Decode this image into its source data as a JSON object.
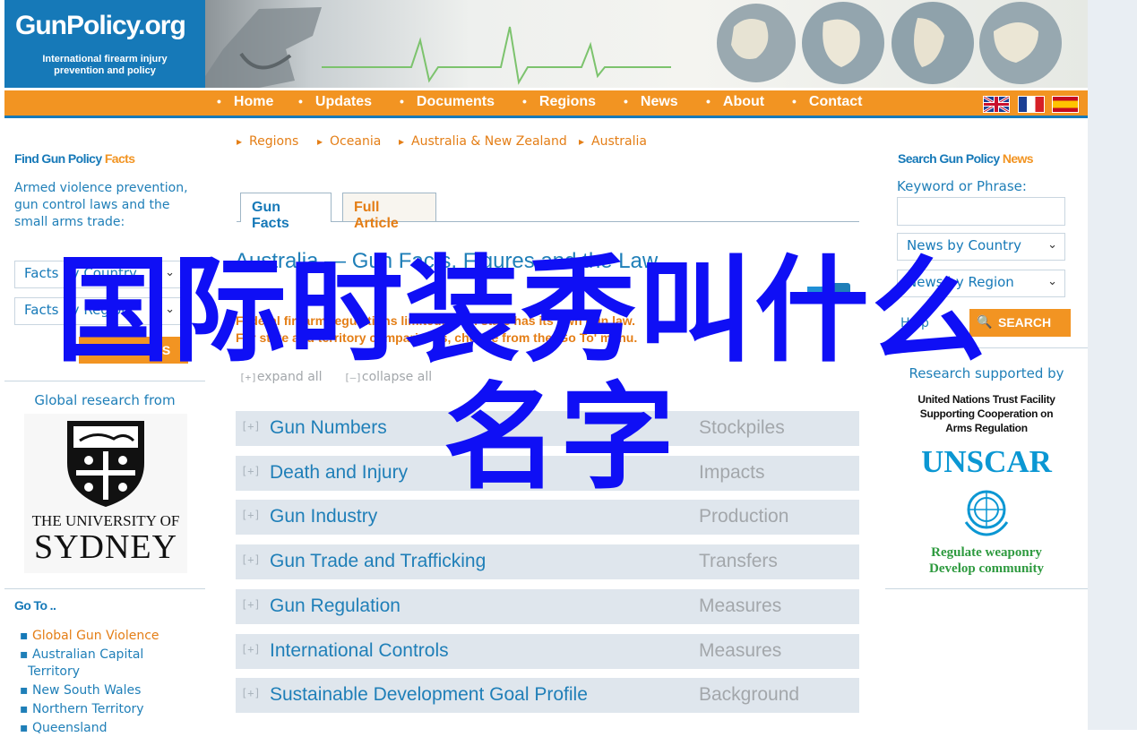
{
  "site": {
    "logo_title": "GunPolicy.org",
    "logo_subtitle_1": "International firearm injury",
    "logo_subtitle_2": "prevention and policy"
  },
  "nav": {
    "items": [
      "Home",
      "Updates",
      "Documents",
      "Regions",
      "News",
      "About",
      "Contact"
    ],
    "flags": [
      "english-flag-icon",
      "french-flag-icon",
      "spanish-flag-icon"
    ]
  },
  "breadcrumb": [
    "Regions",
    "Oceania",
    "Australia & New Zealand",
    "Australia"
  ],
  "tabs": {
    "active": "Gun Facts",
    "other": "Full Article"
  },
  "article": {
    "title": "Australia — Gun Facts, Figures and the Law",
    "notice_1": "Federal firearm regulations limited: each state has its own gun law.",
    "notice_2": "For state and territory comparisons, choose from the 'Go To' menu.",
    "expand_all": "expand all",
    "collapse_all": "collapse all",
    "expand_glyph": "[+]",
    "collapse_glyph": "[–]"
  },
  "sections": [
    {
      "label": "Gun Numbers",
      "category": "Stockpiles"
    },
    {
      "label": "Death and Injury",
      "category": "Impacts"
    },
    {
      "label": "Gun Industry",
      "category": "Production"
    },
    {
      "label": "Gun Trade and Trafficking",
      "category": "Transfers"
    },
    {
      "label": "Gun Regulation",
      "category": "Measures"
    },
    {
      "label": "International Controls",
      "category": "Measures"
    },
    {
      "label": "Sustainable Development Goal Profile",
      "category": "Background"
    }
  ],
  "left": {
    "facts_title_1": "Find Gun Policy",
    "facts_title_2": "Facts",
    "facts_desc": "Armed violence prevention, gun control laws and the small arms trade:",
    "select_1": "Facts by Country",
    "select_2": "Facts by Region",
    "find_button": "FIND FACTS",
    "research_label": "Global research from",
    "university_1": "THE UNIVERSITY OF",
    "university_2": "SYDNEY",
    "goto_title": "Go To ..",
    "goto_items": [
      "Global Gun Violence",
      "Australian Capital Territory",
      "New South Wales",
      "Northern Territory",
      "Queensland"
    ]
  },
  "right": {
    "news_title_1": "Search Gun Policy",
    "news_title_2": "News",
    "keyword_label": "Keyword or Phrase:",
    "keyword_value": "",
    "select_1": "News by Country",
    "select_2": "News by Region",
    "help": "Help",
    "search_button": "SEARCH",
    "supported_by": "Research supported by",
    "unscar_1": "United Nations Trust Facility",
    "unscar_2": "Supporting Cooperation on",
    "unscar_3": "Arms Regulation",
    "unscar_logo": "UNSCAR",
    "unscar_tag_1": "Regulate weaponry",
    "unscar_tag_2": "Develop community"
  },
  "overlay": {
    "line_1": "国际时装秀叫什么",
    "line_2": "名字",
    "color": "#0f0ff5"
  }
}
